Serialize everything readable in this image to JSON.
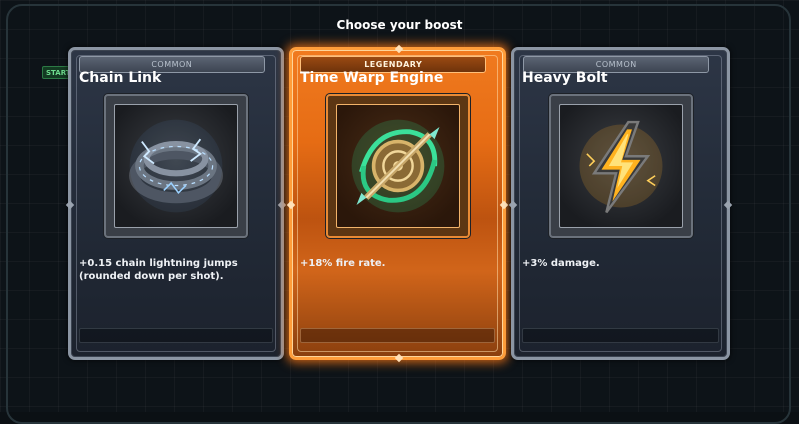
{
  "screen": {
    "title": "Choose your boost",
    "background_tag": "START"
  },
  "cards": [
    {
      "rarity": "COMMON",
      "name": "Chain Link",
      "description": "+0.15 chain lightning jumps (rounded down per shot).",
      "icon": "chain-lightning-icon",
      "accent": "#8b95a3"
    },
    {
      "rarity": "LEGENDARY",
      "name": "Time Warp Engine",
      "description": "+18% fire rate.",
      "icon": "time-warp-engine-icon",
      "accent": "#ff8a1f"
    },
    {
      "rarity": "COMMON",
      "name": "Heavy Bolt",
      "description": "+3% damage.",
      "icon": "lightning-bolt-icon",
      "accent": "#8b95a3"
    }
  ]
}
